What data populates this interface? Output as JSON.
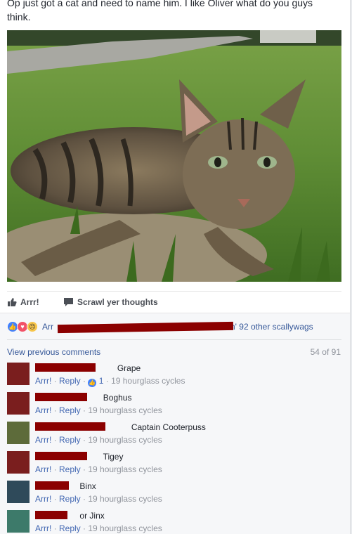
{
  "post": {
    "text": "Op just got a cat and need to name him. I like Oliver what do you guys think."
  },
  "actions": {
    "like_label": "Arrr!",
    "comment_label": "Scrawl yer thoughts"
  },
  "reactions": {
    "prefix": "Arr",
    "suffix": "n' 92 other scallywags",
    "icons": [
      "like-icon",
      "love-icon",
      "sad-icon"
    ]
  },
  "comments_header": {
    "view_previous": "View previous comments",
    "counter": "54 of 91"
  },
  "comments": [
    {
      "text": "Grape",
      "like": "Arrr!",
      "reply": "Reply",
      "reaction_count": "1",
      "time": "19 hourglass cycles"
    },
    {
      "text": "Boghus",
      "like": "Arrr!",
      "reply": "Reply",
      "time": "19 hourglass cycles"
    },
    {
      "text": "Captain Cooterpuss",
      "like": "Arrr!",
      "reply": "Reply",
      "time": "19 hourglass cycles"
    },
    {
      "text": "Tigey",
      "like": "Arrr!",
      "reply": "Reply",
      "time": "19 hourglass cycles"
    },
    {
      "text": "Binx",
      "like": "Arrr!",
      "reply": "Reply",
      "time": "19 hourglass cycles"
    },
    {
      "text": "or Jinx",
      "like": "Arrr!",
      "reply": "Reply",
      "time": "19 hourglass cycles"
    }
  ],
  "colors": {
    "link": "#365899",
    "redaction": "#8b0000",
    "like_blue": "#4080ff"
  }
}
